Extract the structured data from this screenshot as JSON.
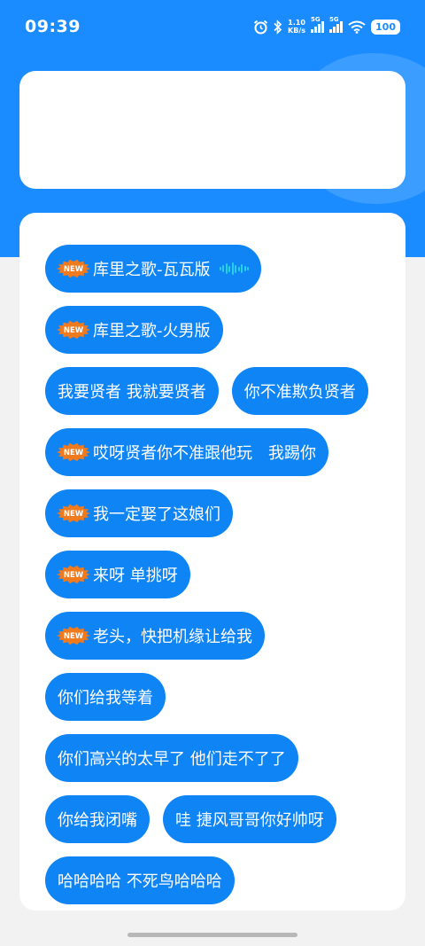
{
  "status_bar": {
    "time": "09:39",
    "net_speed_value": "1.10",
    "net_speed_unit": "KB/s",
    "signal1_label": "5G",
    "signal2_label": "5G",
    "battery": "100"
  },
  "new_badge_text": "NEW",
  "chips": [
    {
      "label": "库里之歌-瓦瓦版",
      "new": true,
      "playing": true
    },
    {
      "label": "库里之歌-火男版",
      "new": true,
      "playing": false
    },
    {
      "label": "我要贤者 我就要贤者",
      "new": false,
      "playing": false
    },
    {
      "label": "你不准欺负贤者",
      "new": false,
      "playing": false
    },
    {
      "label": "哎呀贤者你不准跟他玩　我踢你",
      "new": true,
      "playing": false
    },
    {
      "label": "我一定娶了这娘们",
      "new": true,
      "playing": false
    },
    {
      "label": "来呀 单挑呀",
      "new": true,
      "playing": false
    },
    {
      "label": "老头，快把机缘让给我",
      "new": true,
      "playing": false
    },
    {
      "label": "你们给我等着",
      "new": false,
      "playing": false
    },
    {
      "label": "你们高兴的太早了  他们走不了了",
      "new": false,
      "playing": false
    },
    {
      "label": "你给我闭嘴",
      "new": false,
      "playing": false
    },
    {
      "label": "哇 捷风哥哥你好帅呀",
      "new": false,
      "playing": false
    },
    {
      "label": "哈哈哈哈 不死鸟哈哈哈",
      "new": false,
      "playing": false
    }
  ],
  "colors": {
    "header_blue": "#1a8cff",
    "chip_blue": "#0f84f5",
    "new_badge_orange": "#f07a1e",
    "wave_cyan": "#27d0e6"
  }
}
